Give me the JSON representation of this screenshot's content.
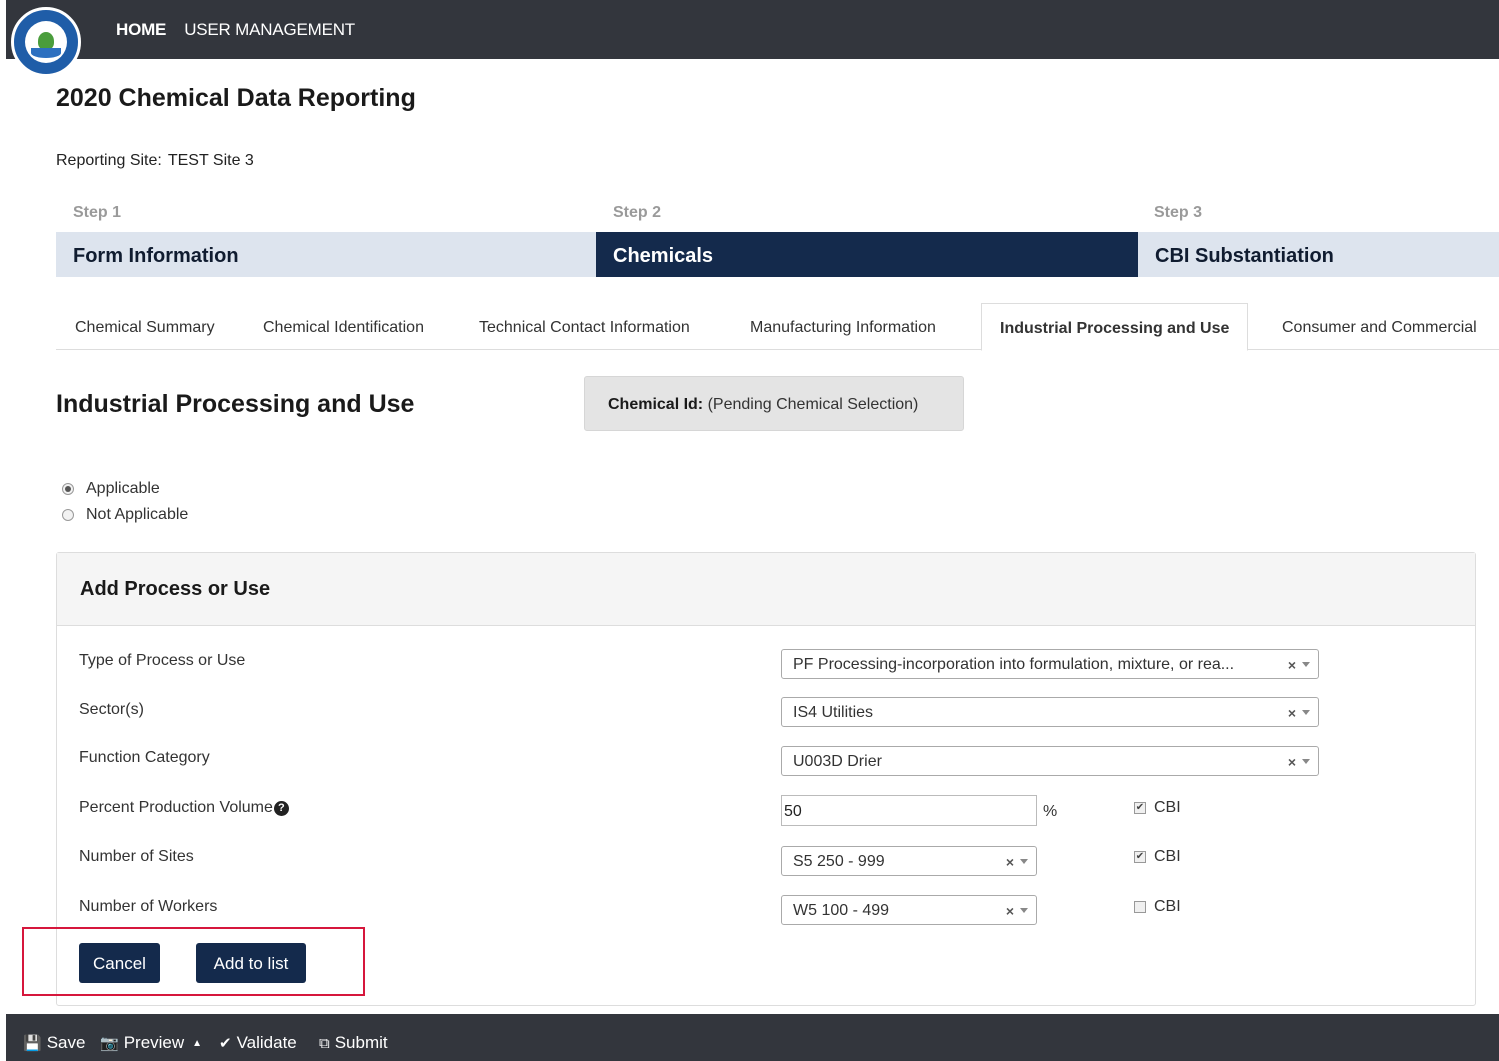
{
  "nav": {
    "home": "HOME",
    "user_management": "USER MANAGEMENT"
  },
  "page": {
    "title": "2020 Chemical Data Reporting",
    "site_label": "Reporting Site:",
    "site_value": "TEST Site 3"
  },
  "steps": [
    {
      "label": "Step 1",
      "title": "Form Information"
    },
    {
      "label": "Step 2",
      "title": "Chemicals"
    },
    {
      "label": "Step 3",
      "title": "CBI Substantiation"
    }
  ],
  "tabs": [
    "Chemical Summary",
    "Chemical Identification",
    "Technical Contact Information",
    "Manufacturing Information",
    "Industrial Processing and Use",
    "Consumer and Commercial"
  ],
  "section": {
    "title": "Industrial Processing and Use",
    "chem_id_label": "Chemical Id:",
    "chem_id_value": "(Pending Chemical Selection)",
    "applicable": "Applicable",
    "not_applicable": "Not Applicable"
  },
  "panel": {
    "title": "Add Process or Use",
    "fields": {
      "type_label": "Type of Process or Use",
      "type_value": "PF Processing-incorporation into formulation, mixture, or rea...",
      "sector_label": "Sector(s)",
      "sector_value": "IS4 Utilities",
      "function_label": "Function Category",
      "function_value": "U003D Drier",
      "ppv_label": "Percent Production Volume",
      "ppv_value": "50",
      "ppv_unit": "%",
      "sites_label": "Number of Sites",
      "sites_value": "S5 250 - 999",
      "workers_label": "Number of Workers",
      "workers_value": "W5 100 - 499",
      "cbi": "CBI",
      "clear": "×"
    },
    "cancel": "Cancel",
    "add": "Add to list"
  },
  "bottom": {
    "save": "Save",
    "preview": "Preview",
    "validate": "Validate",
    "submit": "Submit"
  }
}
